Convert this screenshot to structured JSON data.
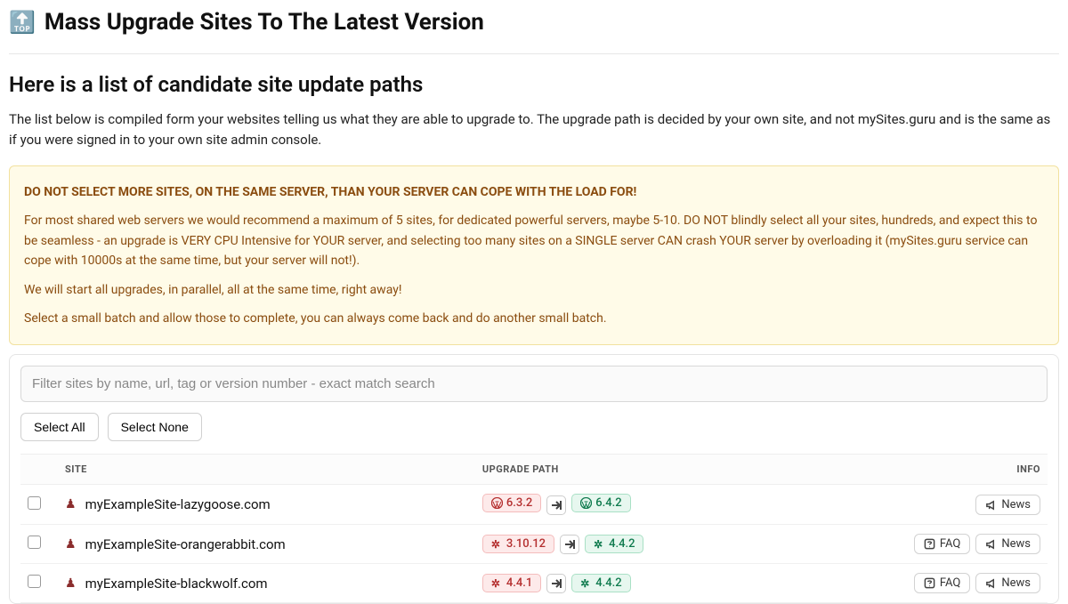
{
  "page_title": "Mass Upgrade Sites To The Latest Version",
  "page_title_emoji": "🔝",
  "section_heading": "Here is a list of candidate site update paths",
  "intro_text": "The list below is compiled form your websites telling us what they are able to upgrade to. The upgrade path is decided by your own site, and not mySites.guru and is the same as if you were signed in to your own site admin console.",
  "alert": {
    "bold_line": "DO NOT SELECT MORE SITES, ON THE SAME SERVER, THAN YOUR SERVER CAN COPE WITH THE LOAD FOR!",
    "p1": "For most shared web servers we would recommend a maximum of 5 sites, for dedicated powerful servers, maybe 5-10. DO NOT blindly select all your sites, hundreds, and expect this to be seamless - an upgrade is VERY CPU Intensive for YOUR server, and selecting too many sites on a SINGLE server CAN crash YOUR server by overloading it (mySites.guru service can cope with 10000s at the same time, but your server will not!).",
    "p2": "We will start all upgrades, in parallel, all at the same time, right away!",
    "p3": "Select a small batch and allow those to complete, you can always come back and do another small batch."
  },
  "filter": {
    "placeholder": "Filter sites by name, url, tag or version number - exact match search"
  },
  "buttons": {
    "select_all": "Select All",
    "select_none": "Select None"
  },
  "table": {
    "headers": {
      "site": "SITE",
      "upgrade_path": "UPGRADE PATH",
      "info": "INFO"
    },
    "rows": [
      {
        "cms": "wordpress",
        "site": "myExampleSite-lazygoose.com",
        "from": "6.3.2",
        "to": "6.4.2",
        "info_buttons": [
          "news"
        ]
      },
      {
        "cms": "joomla",
        "site": "myExampleSite-orangerabbit.com",
        "from": "3.10.12",
        "to": "4.4.2",
        "info_buttons": [
          "faq",
          "news"
        ]
      },
      {
        "cms": "joomla",
        "site": "myExampleSite-blackwolf.com",
        "from": "4.4.1",
        "to": "4.4.2",
        "info_buttons": [
          "faq",
          "news"
        ]
      }
    ]
  },
  "info_labels": {
    "faq": "FAQ",
    "news": "News"
  }
}
